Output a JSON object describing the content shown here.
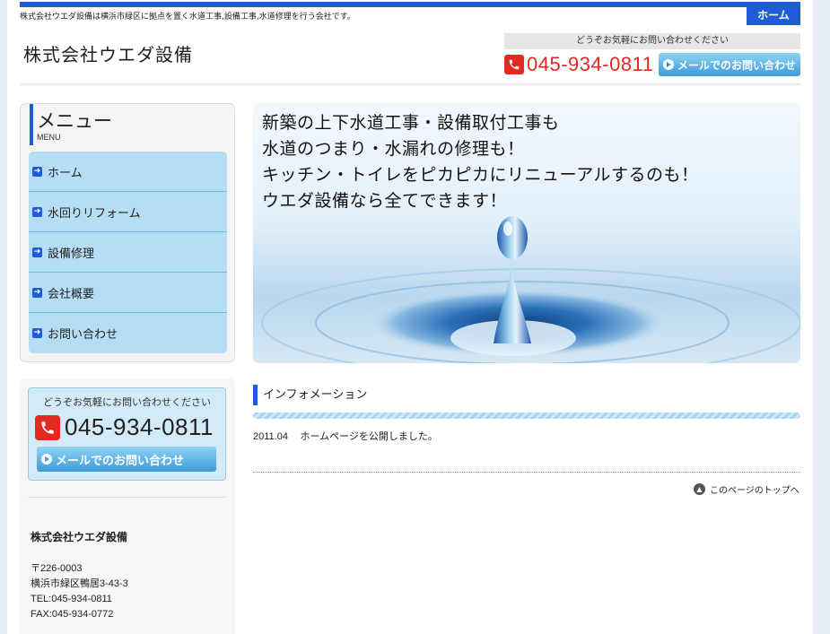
{
  "header": {
    "tagline": "株式会社ウエダ設備は横浜市緑区に拠点を置く水道工事,設備工事,水道修理を行う会社です。",
    "home_tab": "ホーム",
    "site_title": "株式会社ウエダ設備",
    "contact_note": "どうぞお気軽にお問い合わせください",
    "phone": "045-934-0811",
    "mail_button": "メールでのお問い合わせ"
  },
  "menu": {
    "title": "メニュー",
    "subtitle": "MENU",
    "items": [
      {
        "label": "ホーム"
      },
      {
        "label": "水回りリフォーム"
      },
      {
        "label": "設備修理"
      },
      {
        "label": "会社概要"
      },
      {
        "label": "お問い合わせ"
      }
    ]
  },
  "sidebar_contact": {
    "note": "どうぞお気軽にお問い合わせください",
    "phone": "045-934-0811",
    "mail_button": "メールでのお問い合わせ"
  },
  "company": {
    "name": "株式会社ウエダ設備",
    "postal": "〒226-0003",
    "address": "横浜市緑区鴨居3-43-3",
    "tel": "TEL:045-934-0811",
    "fax": "FAX:045-934-0772"
  },
  "hero": {
    "lines": [
      "新築の上下水道工事・設備取付工事も",
      "水道のつまり・水漏れの修理も！",
      "キッチン・トイレをピカピカにリニューアルするのも！",
      "ウエダ設備なら全てできます！"
    ]
  },
  "info": {
    "heading": "インフォメーション",
    "items": [
      {
        "date": "2011.04",
        "text": "ホームページを公開しました。"
      }
    ],
    "pagetop": "このページのトップへ"
  },
  "colors": {
    "accent": "#1e5bd8",
    "phone_red": "#e32a22",
    "menu_bg": "#b5def5"
  }
}
